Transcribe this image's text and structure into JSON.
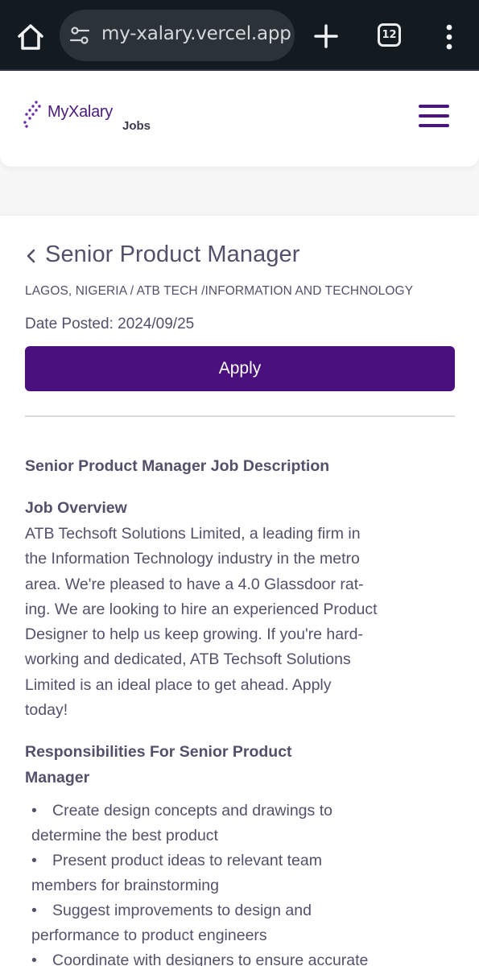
{
  "browser": {
    "url_prefix": "",
    "url": "my-xalary.vercel.app",
    "tab_count": "12"
  },
  "header": {
    "logo_name": "MyXalary",
    "logo_sub": "Jobs"
  },
  "job": {
    "back_icon": "chevron-left-icon",
    "title": "Senior Product Manager",
    "location": "LAGOS, NIGERIA / ATB TECH /INFORMATION AND TECHNOLOGY",
    "date_posted": "Date Posted: 2024/09/25",
    "apply_label": "Apply",
    "description_heading": "Senior Product Manager Job Description",
    "overview_heading": "Job Overview",
    "overview_lines": [
      "ATB Techsoft Solutions Limited, a leading firm in",
      "the Information Technology industry in the metro",
      "area. We're pleased to have a 4.0 Glassdoor rat-",
      "ing. We are looking to hire an experienced Product",
      "Designer to help us keep growing. If you're hard-",
      "working and dedicated, ATB Techsoft Solutions",
      "Limited is an ideal place to get ahead. Apply",
      "today!"
    ],
    "responsibilities_heading_line1": "Responsibilities For Senior Product",
    "responsibilities_heading_line2": "Manager",
    "responsibilities_lines": [
      "•",
      "Create design concepts and drawings to",
      "determine the best product",
      "Present product ideas to relevant team",
      "members for brainstorming",
      "Suggest improvements to design and",
      "performance to product engineers",
      "Coordinate with designers to ensure accurate"
    ]
  },
  "colors": {
    "brand_purple": "#4a117e",
    "chrome_bg": "#131a20",
    "text": "#55506a"
  }
}
